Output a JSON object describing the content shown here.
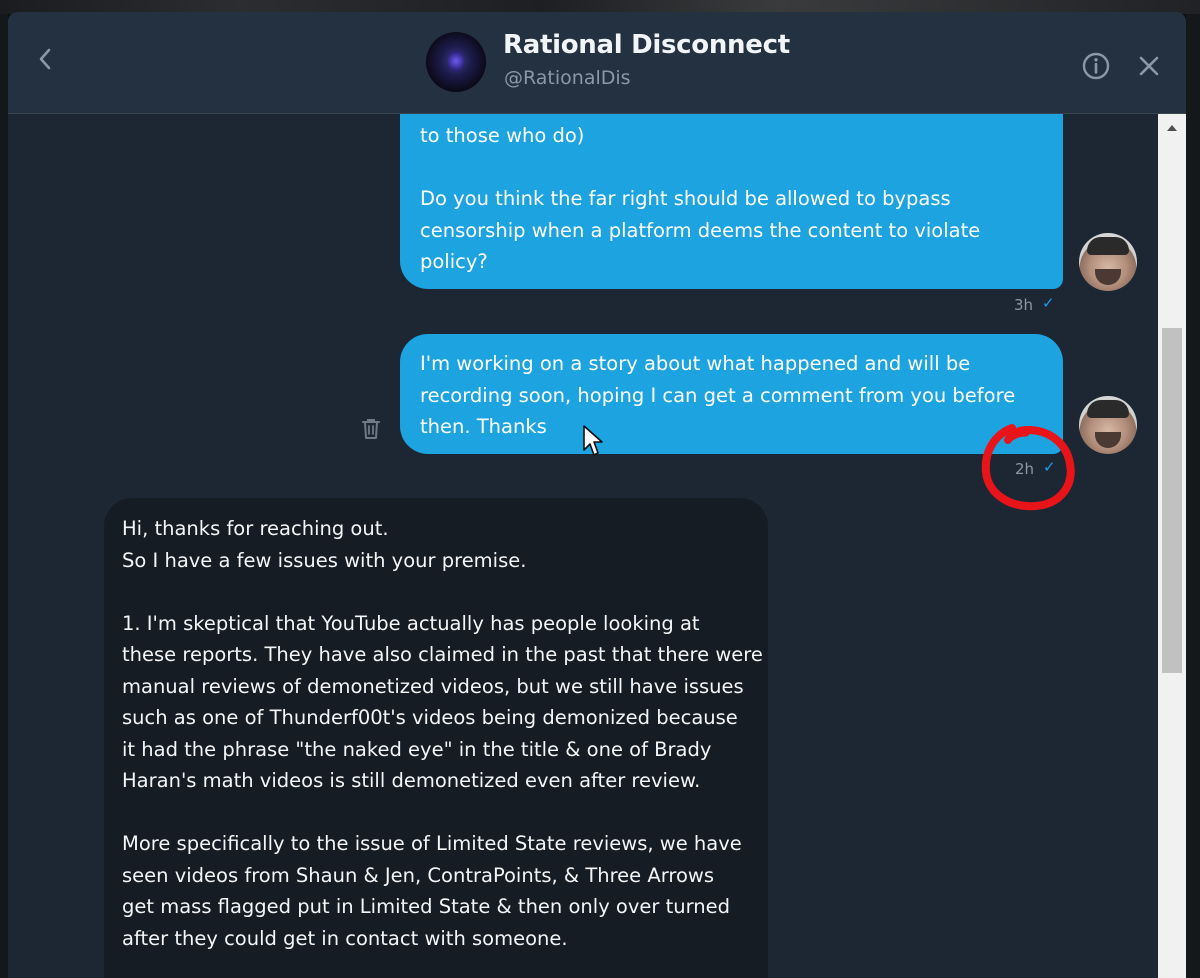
{
  "conversation": {
    "name": "Rational Disconnect",
    "handle": "@RationalDis"
  },
  "messages": {
    "outgoing_1": {
      "lines": [
        "to those who do)",
        "",
        "Do you think the far right should be allowed to bypass",
        "censorship when a platform deems the content to violate",
        "policy?"
      ],
      "time": "3h",
      "check": "✓"
    },
    "outgoing_2": {
      "lines": [
        "I'm working on a story about what happened and will be",
        "recording soon, hoping I can get a comment from you before",
        "then. Thanks"
      ],
      "time": "2h",
      "check": "✓"
    },
    "incoming_1": {
      "lines": [
        "Hi, thanks for reaching out.",
        "So I have a few issues with your premise.",
        "",
        "1. I'm skeptical that YouTube actually has people looking at",
        "these reports. They have also claimed in the past that there were",
        "manual reviews of demonetized videos, but we still have issues",
        "such as one of Thunderf00t's videos being demonized because",
        "it had the phrase \"the naked eye\" in the title & one of Brady",
        "Haran's math videos is still demonetized even after review.",
        "",
        "More specifically to the issue of Limited State reviews, we have",
        "seen videos from Shaun & Jen, ContraPoints, & Three Arrows",
        "get mass flagged put in Limited State & then only over turned",
        "after they could get in contact with someone."
      ]
    }
  },
  "colors": {
    "outgoing_bubble": "#1ca3e0",
    "incoming_bubble": "#161c23",
    "background": "#1d2733",
    "header": "#243140",
    "annotation": "#e8141a",
    "accent": "#1d9bf0"
  },
  "icons": {
    "back": "chevron-left-icon",
    "info": "info-icon",
    "close": "close-icon",
    "delete": "trash-icon"
  }
}
